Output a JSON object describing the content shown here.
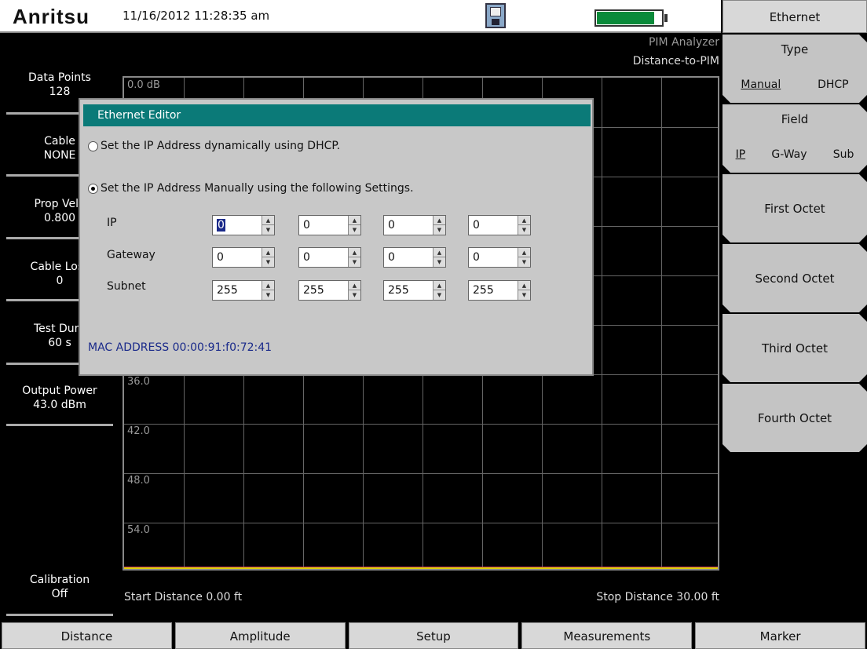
{
  "header": {
    "brand": "Anritsu",
    "datetime": "11/16/2012 11:28:35 am",
    "save_icon": "floppy-disk-icon",
    "battery_level": 0.87
  },
  "mode": {
    "name": "PIM Analyzer",
    "measurement": "Distance-to-PIM"
  },
  "params": [
    {
      "label": "Data Points",
      "value": "128"
    },
    {
      "label": "Cable",
      "value": "NONE"
    },
    {
      "label": "Prop Velo",
      "value": "0.800"
    },
    {
      "label": "Cable Loss",
      "value": "0"
    },
    {
      "label": "Test Dura",
      "value": "60 s"
    },
    {
      "label": "Output Power",
      "value": "43.0 dBm"
    },
    {
      "label": "Calibration",
      "value": "Off"
    }
  ],
  "graph": {
    "y_labels": [
      "0.0 dB",
      "36.0",
      "42.0",
      "48.0",
      "54.0"
    ],
    "start": "Start Distance 0.00 ft",
    "stop": "Stop Distance 30.00 ft"
  },
  "menu": {
    "title": "Ethernet",
    "type": {
      "label": "Type",
      "options": [
        "Manual",
        "DHCP"
      ],
      "selected": "Manual"
    },
    "field": {
      "label": "Field",
      "options": [
        "IP",
        "G-Way",
        "Sub"
      ],
      "selected": "IP"
    },
    "keys": [
      "First Octet",
      "Second Octet",
      "Third Octet",
      "Fourth Octet"
    ]
  },
  "tabs": [
    "Distance",
    "Amplitude",
    "Setup",
    "Measurements",
    "Marker"
  ],
  "dialog": {
    "title": "Ethernet Editor",
    "dhcp_option": "Set the IP Address dynamically using DHCP.",
    "manual_option": "Set the IP Address Manually using the following Settings.",
    "selected": "manual",
    "rows": [
      {
        "label": "IP",
        "octets": [
          "0",
          "0",
          "0",
          "0"
        ]
      },
      {
        "label": "Gateway",
        "octets": [
          "0",
          "0",
          "0",
          "0"
        ]
      },
      {
        "label": "Subnet",
        "octets": [
          "255",
          "255",
          "255",
          "255"
        ]
      }
    ],
    "mac": "MAC ADDRESS 00:00:91:f0:72:41"
  }
}
